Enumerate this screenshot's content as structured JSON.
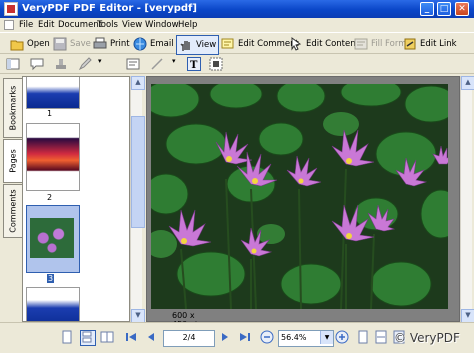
{
  "window": {
    "title": "VeryPDF PDF Editor - [verypdf]"
  },
  "menu": [
    "File",
    "Edit",
    "Document",
    "Tools",
    "View",
    "Window",
    "Help"
  ],
  "toolbar": {
    "open": "Open",
    "save": "Save",
    "print": "Print",
    "email": "Email",
    "view": "View",
    "edit_comment": "Edit Comment",
    "edit_content": "Edit Content",
    "fill_form": "Fill Form",
    "edit_link": "Edit Link"
  },
  "side_tabs": [
    "Bookmarks",
    "Pages",
    "Comments"
  ],
  "thumbnails": [
    {
      "label": "1",
      "selected": false
    },
    {
      "label": "2",
      "selected": false
    },
    {
      "label": "3",
      "selected": true
    }
  ],
  "viewer": {
    "image_size": "600 x 450 pt"
  },
  "status": {
    "page": "2/4",
    "zoom": "56.4%",
    "watermark": "© VeryPDF"
  },
  "colors": {
    "titlebar": "#0a46c8",
    "selection": "#2f5fb0",
    "lotus": "#c86ad8"
  }
}
